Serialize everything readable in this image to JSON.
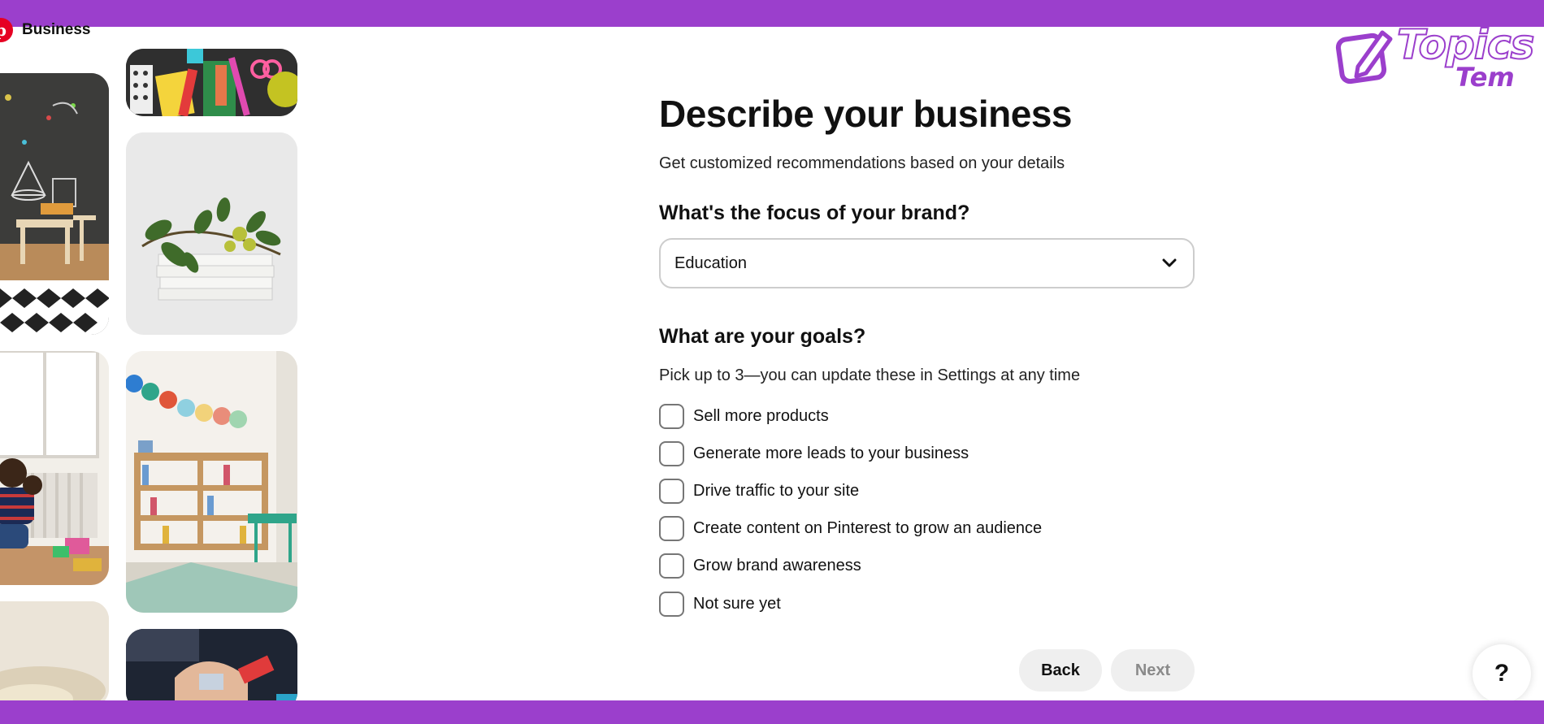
{
  "header": {
    "brand_name": "Business",
    "brand_logo_letter": "p"
  },
  "form": {
    "title": "Describe your business",
    "subtitle": "Get customized recommendations based on your details",
    "focus_heading": "What's the focus of your brand?",
    "focus_selected": "Education",
    "goals_heading": "What are your goals?",
    "goals_hint": "Pick up to 3—you can update these in Settings at any time",
    "goals": [
      {
        "label": "Sell more products",
        "checked": false
      },
      {
        "label": "Generate more leads to your business",
        "checked": false
      },
      {
        "label": "Drive traffic to your site",
        "checked": false
      },
      {
        "label": "Create content on Pinterest to grow an audience",
        "checked": false
      },
      {
        "label": "Grow brand awareness",
        "checked": false
      },
      {
        "label": "Not sure yet",
        "checked": false
      }
    ],
    "back_label": "Back",
    "next_label": "Next"
  },
  "help_label": "?",
  "watermark": {
    "title": "Topics",
    "sub": "Tem"
  },
  "colors": {
    "accent_bar": "#9b3fcc",
    "pinterest_red": "#e60023"
  }
}
